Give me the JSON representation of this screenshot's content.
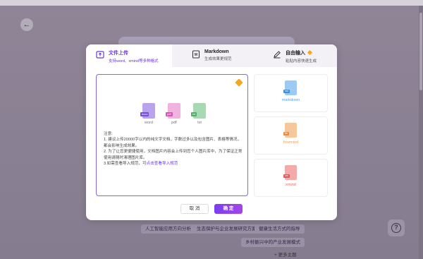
{
  "background": {
    "title_bar_text": "",
    "chips": [
      "人工智能应用方向分析",
      "生态保护与企业发展研究方案",
      "健康生活方式的指导",
      "乡村振兴中的产业发展模式"
    ],
    "more_topics": "+ 更多主题"
  },
  "modal": {
    "tabs": [
      {
        "title": "文件上传",
        "subtitle": "支持word、xmind等多种格式"
      },
      {
        "title": "Markdown",
        "subtitle": "生成效果更规范"
      },
      {
        "title": "自由输入",
        "subtitle": "粘贴内容快速生成"
      }
    ],
    "files": [
      {
        "tag": "docx",
        "label": "word"
      },
      {
        "tag": "pdf",
        "label": "pdf"
      },
      {
        "tag": "txt",
        "label": "txt"
      }
    ],
    "notes_title": "注意:",
    "notes": [
      "1. 建议上传20000字以内的纯文字文档，字数过多以及包含图片、表格等情况，都会影响生成效果。",
      "2. 为了让您更便捷使用，文档图片内容会上传到您个人图片库中，为了保证正常使用请随时清理图片库。"
    ],
    "note3_prefix": "3.如需查看导入规范，可",
    "note3_link": "点击查看导入规范",
    "types": [
      {
        "tag": "md",
        "label": "markdown",
        "color": "#5aa0e6"
      },
      {
        "tag": "fm",
        "label": "freemind",
        "color": "#f0a050"
      },
      {
        "tag": "xm",
        "label": "xmind",
        "color": "#e86b6b"
      }
    ],
    "cancel_label": "取 消",
    "ok_label": "确 定"
  }
}
